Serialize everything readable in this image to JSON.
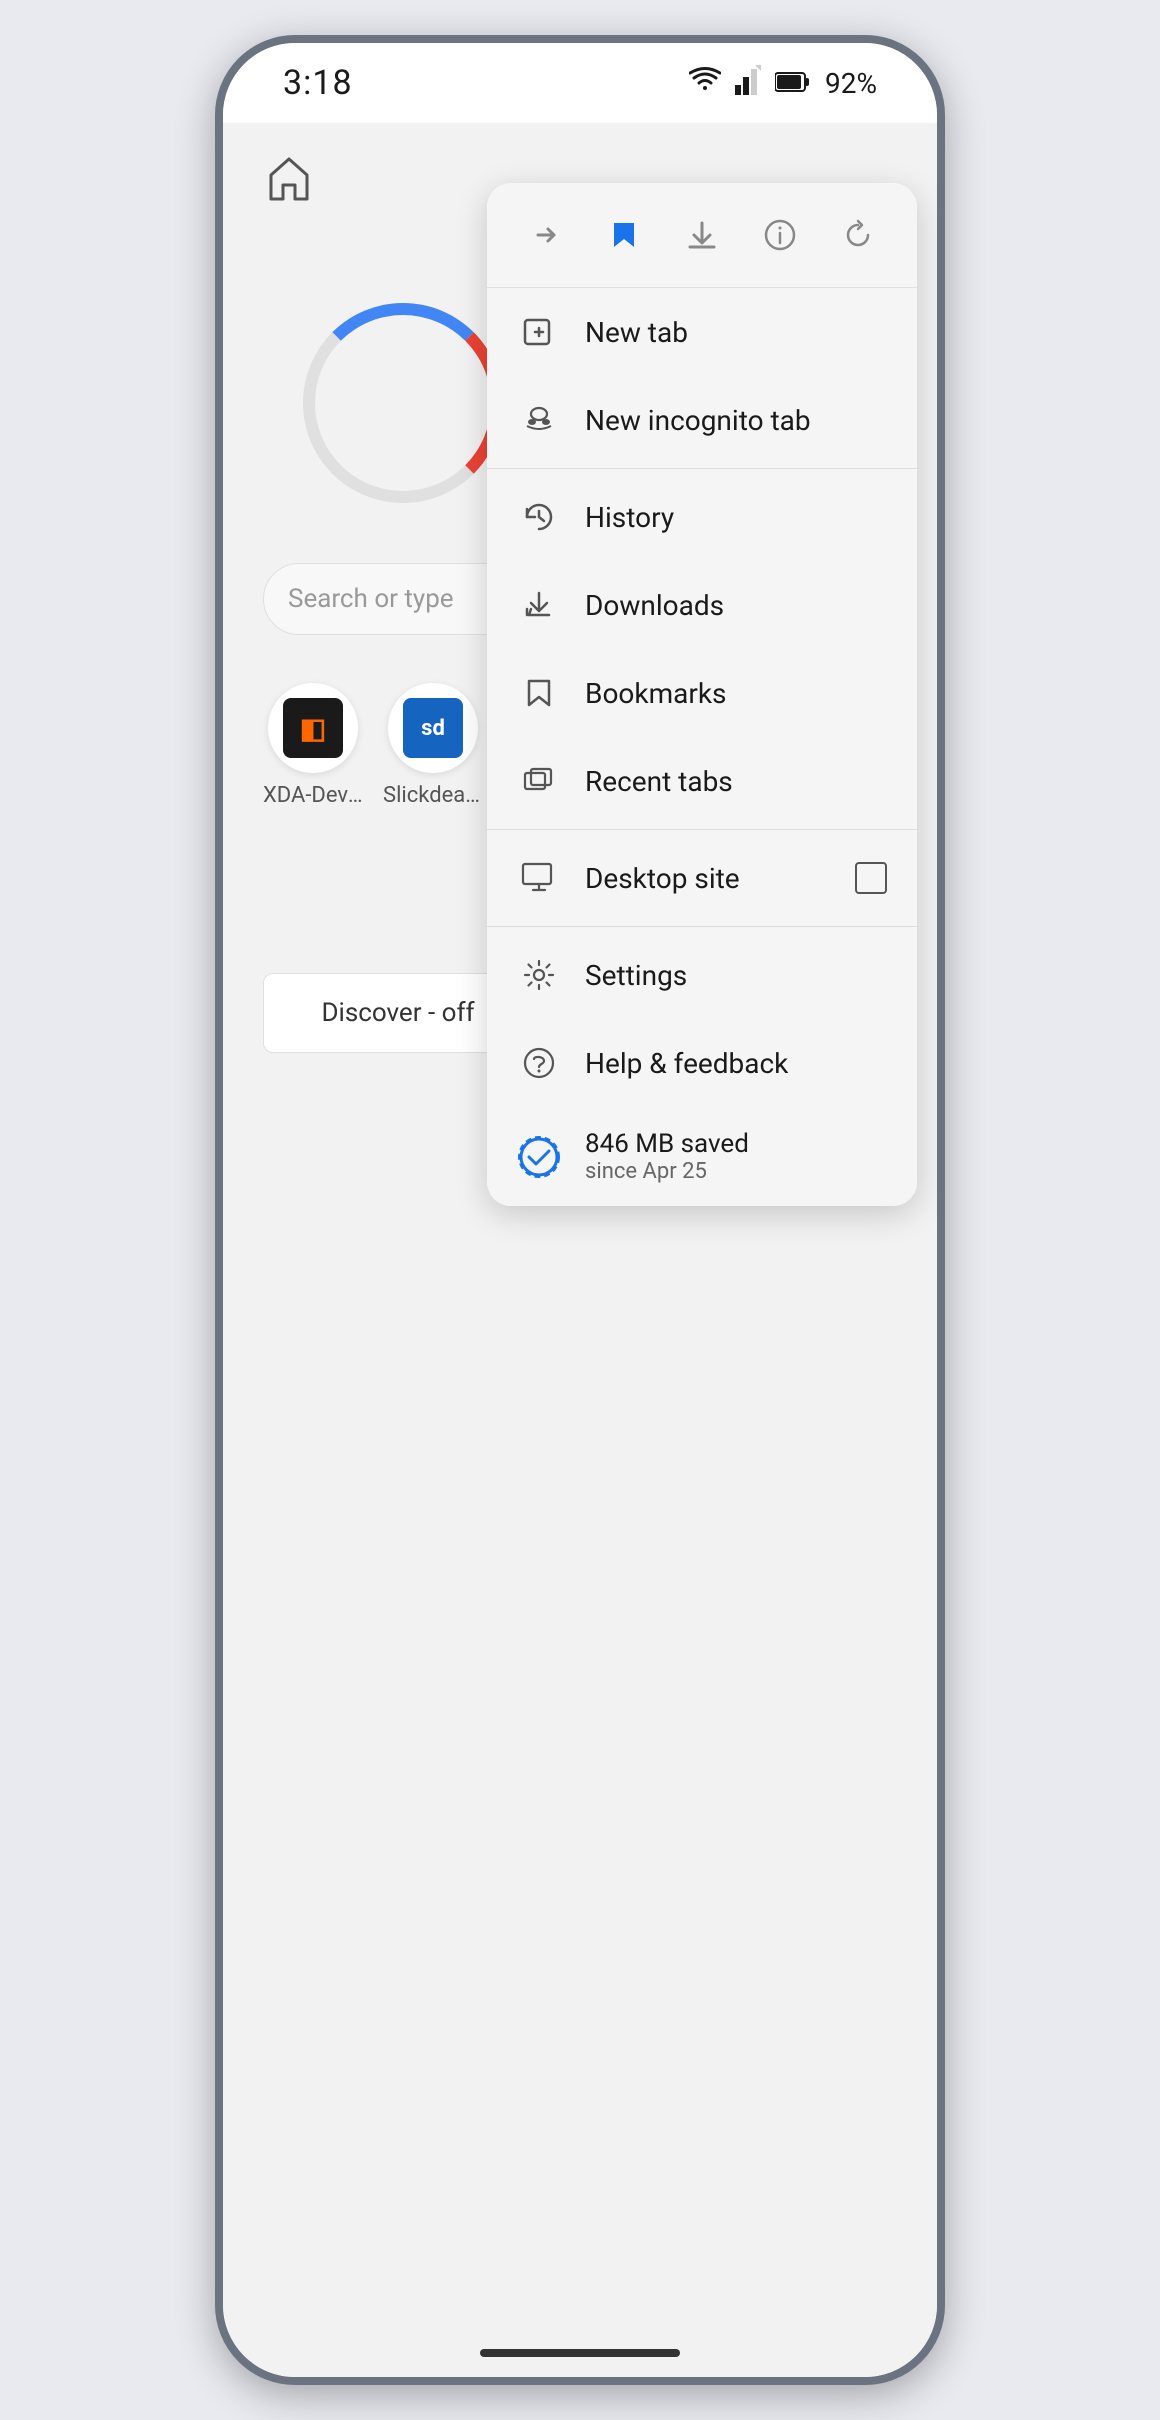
{
  "statusBar": {
    "time": "3:18",
    "battery": "92%"
  },
  "searchBar": {
    "placeholder": "Search or type"
  },
  "shortcuts": [
    {
      "id": "xda",
      "label": "XDA-Develo...",
      "iconText": "◧"
    },
    {
      "id": "sd",
      "label": "Slickdeals: ...",
      "iconText": "sd"
    }
  ],
  "discoverOff": {
    "label": "Discover - off"
  },
  "menu": {
    "toolbar": {
      "forward": "→",
      "bookmark_star": "★",
      "download": "⬇",
      "info": "ℹ",
      "refresh": "↺"
    },
    "items": [
      {
        "id": "new-tab",
        "label": "New tab",
        "icon": "new-tab-icon"
      },
      {
        "id": "new-incognito-tab",
        "label": "New incognito tab",
        "icon": "incognito-icon"
      },
      {
        "id": "history",
        "label": "History",
        "icon": "history-icon"
      },
      {
        "id": "downloads",
        "label": "Downloads",
        "icon": "downloads-icon"
      },
      {
        "id": "bookmarks",
        "label": "Bookmarks",
        "icon": "bookmarks-icon"
      },
      {
        "id": "recent-tabs",
        "label": "Recent tabs",
        "icon": "recent-tabs-icon"
      },
      {
        "id": "desktop-site",
        "label": "Desktop site",
        "icon": "desktop-icon"
      },
      {
        "id": "settings",
        "label": "Settings",
        "icon": "settings-icon"
      },
      {
        "id": "help-feedback",
        "label": "Help & feedback",
        "icon": "help-icon"
      }
    ],
    "savings": {
      "main": "846 MB saved",
      "sub": "since Apr 25"
    }
  }
}
